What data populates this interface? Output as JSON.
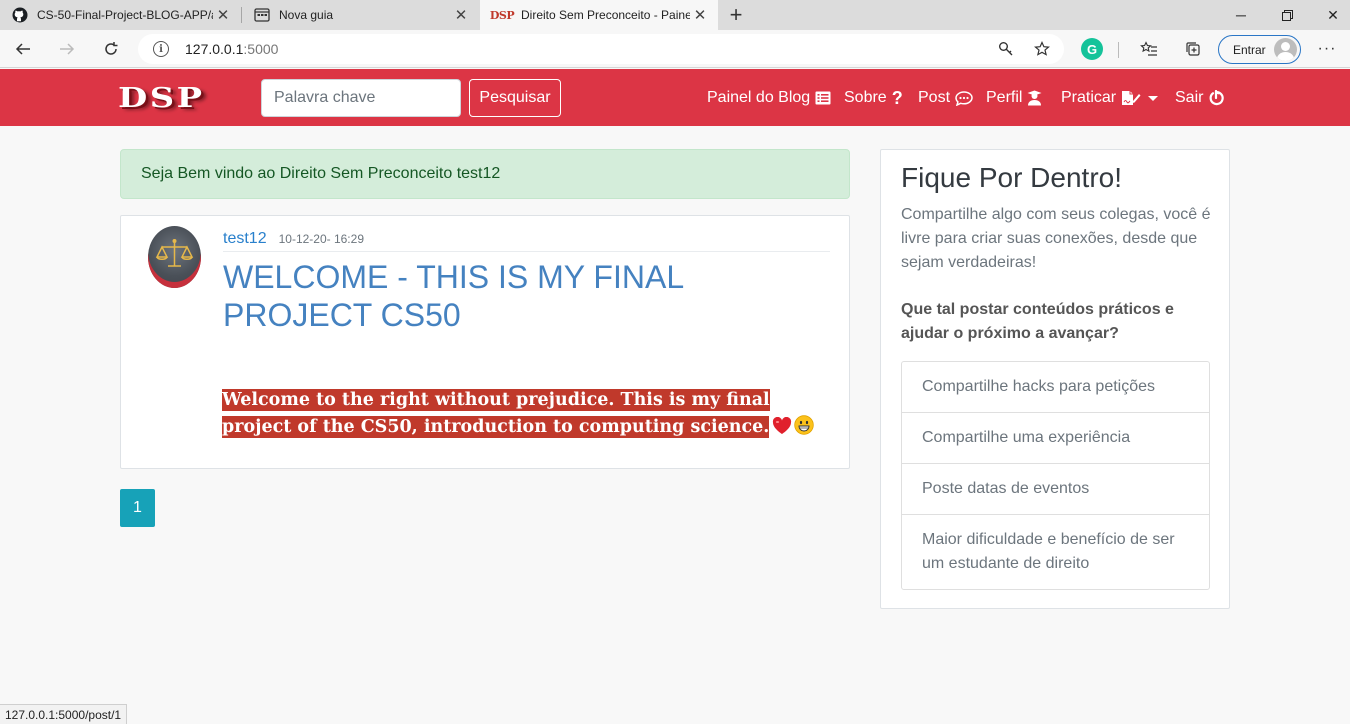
{
  "browser": {
    "tabs": [
      {
        "label": "CS-50-Final-Project-BLOG-APP/a",
        "icon": "github-icon"
      },
      {
        "label": "Nova guia",
        "icon": "new-tab-page-icon"
      },
      {
        "label": "Direito Sem Preconceito - Painel",
        "icon": "dsp-favicon",
        "favicon_text": "DSP",
        "active": true
      }
    ],
    "address": {
      "host": "127.0.0.1",
      "port": ":5000"
    },
    "signin_label": "Entrar",
    "status_url": "127.0.0.1:5000/post/1"
  },
  "navbar": {
    "brand": "DSP",
    "search_placeholder": "Palavra chave",
    "search_button": "Pesquisar",
    "items": [
      {
        "label": "Painel do Blog",
        "icon": "list-alt-icon"
      },
      {
        "label": "Sobre",
        "icon": "question-icon"
      },
      {
        "label": "Post",
        "icon": "comment-dots-icon"
      },
      {
        "label": "Perfil",
        "icon": "user-graduate-icon"
      },
      {
        "label": "Praticar",
        "icon": "file-signature-icon"
      },
      {
        "label": "Sair",
        "icon": "power-off-icon"
      }
    ],
    "color": "#dc3545"
  },
  "alert": {
    "text": "Seja Bem vindo ao Direito Sem Preconceito test12"
  },
  "post": {
    "author": "test12",
    "date": "10-12-20- 16:29",
    "title": "WELCOME - THIS IS MY FINAL PROJECT CS50",
    "body": "Welcome to the right without prejudice.  This is my final project of the CS50, introduction to computing science.",
    "emojis": [
      "heart-emoji",
      "grinning-emoji"
    ]
  },
  "pagination": {
    "current": "1"
  },
  "sidebar": {
    "title": "Fique Por Dentro!",
    "text": "Compartilhe algo com seus colegas, você é livre para criar suas conexões, desde que sejam verdadeiras!",
    "question": "Que tal postar conteúdos práticos e ajudar o próximo a avançar?",
    "items": [
      "Compartilhe hacks para petições",
      "Compartilhe uma experiência",
      "Poste datas de eventos",
      "Maior dificuldade e benefício de ser um estudante de direito"
    ]
  }
}
